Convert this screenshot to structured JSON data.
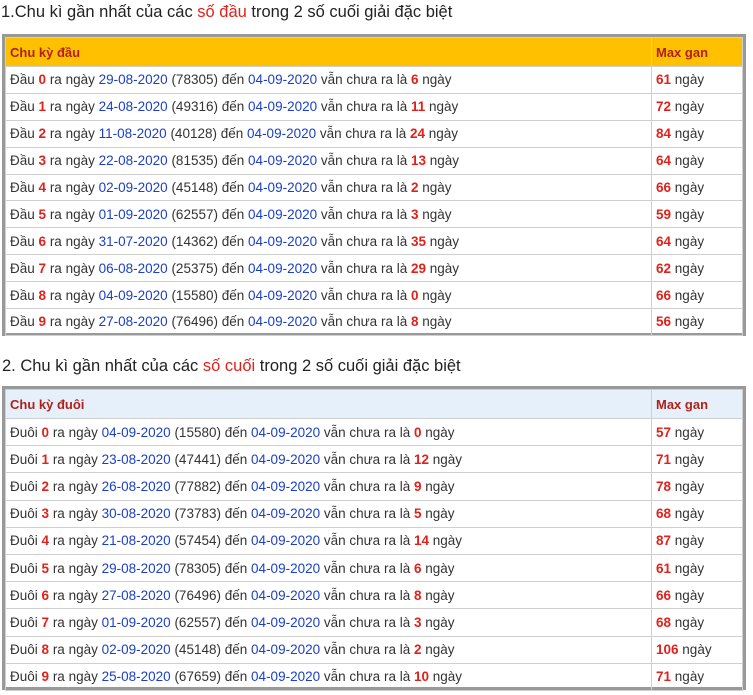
{
  "section1": {
    "title_prefix": "1.Chu kì gần nhất của các ",
    "title_highlight": "số đầu",
    "title_suffix": " trong 2 số cuối giải đặc biệt",
    "header_left": "Chu kỳ đầu",
    "header_right": "Max gan",
    "label": "Đầu",
    "rows": [
      {
        "digit": "0",
        "date": "29-08-2020",
        "code": "(78305)",
        "end": "04-09-2020",
        "days": "6",
        "max": "61"
      },
      {
        "digit": "1",
        "date": "24-08-2020",
        "code": "(49316)",
        "end": "04-09-2020",
        "days": "11",
        "max": "72"
      },
      {
        "digit": "2",
        "date": "11-08-2020",
        "code": "(40128)",
        "end": "04-09-2020",
        "days": "24",
        "max": "84"
      },
      {
        "digit": "3",
        "date": "22-08-2020",
        "code": "(81535)",
        "end": "04-09-2020",
        "days": "13",
        "max": "64"
      },
      {
        "digit": "4",
        "date": "02-09-2020",
        "code": "(45148)",
        "end": "04-09-2020",
        "days": "2",
        "max": "66"
      },
      {
        "digit": "5",
        "date": "01-09-2020",
        "code": "(62557)",
        "end": "04-09-2020",
        "days": "3",
        "max": "59"
      },
      {
        "digit": "6",
        "date": "31-07-2020",
        "code": "(14362)",
        "end": "04-09-2020",
        "days": "35",
        "max": "64"
      },
      {
        "digit": "7",
        "date": "06-08-2020",
        "code": "(25375)",
        "end": "04-09-2020",
        "days": "29",
        "max": "62"
      },
      {
        "digit": "8",
        "date": "04-09-2020",
        "code": "(15580)",
        "end": "04-09-2020",
        "days": "0",
        "max": "66"
      },
      {
        "digit": "9",
        "date": "27-08-2020",
        "code": "(76496)",
        "end": "04-09-2020",
        "days": "8",
        "max": "56"
      }
    ]
  },
  "section2": {
    "title_prefix": "2. Chu kì gần nhất của các ",
    "title_highlight": "số cuối",
    "title_suffix": " trong 2 số cuối giải đặc biệt",
    "header_left": "Chu kỳ đuôi",
    "header_right": "Max gan",
    "label": "Đuôi",
    "rows": [
      {
        "digit": "0",
        "date": "04-09-2020",
        "code": "(15580)",
        "end": "04-09-2020",
        "days": "0",
        "max": "57"
      },
      {
        "digit": "1",
        "date": "23-08-2020",
        "code": "(47441)",
        "end": "04-09-2020",
        "days": "12",
        "max": "71"
      },
      {
        "digit": "2",
        "date": "26-08-2020",
        "code": "(77882)",
        "end": "04-09-2020",
        "days": "9",
        "max": "78"
      },
      {
        "digit": "3",
        "date": "30-08-2020",
        "code": "(73783)",
        "end": "04-09-2020",
        "days": "5",
        "max": "68"
      },
      {
        "digit": "4",
        "date": "21-08-2020",
        "code": "(57454)",
        "end": "04-09-2020",
        "days": "14",
        "max": "87"
      },
      {
        "digit": "5",
        "date": "29-08-2020",
        "code": "(78305)",
        "end": "04-09-2020",
        "days": "6",
        "max": "61"
      },
      {
        "digit": "6",
        "date": "27-08-2020",
        "code": "(76496)",
        "end": "04-09-2020",
        "days": "8",
        "max": "66"
      },
      {
        "digit": "7",
        "date": "01-09-2020",
        "code": "(62557)",
        "end": "04-09-2020",
        "days": "3",
        "max": "68"
      },
      {
        "digit": "8",
        "date": "02-09-2020",
        "code": "(45148)",
        "end": "04-09-2020",
        "days": "2",
        "max": "106"
      },
      {
        "digit": "9",
        "date": "25-08-2020",
        "code": "(67659)",
        "end": "04-09-2020",
        "days": "10",
        "max": "71"
      }
    ]
  },
  "common": {
    "ra_ngay": "ra ngày",
    "den": "đến",
    "van_chua": "vẫn chưa ra là",
    "ngay": "ngày"
  },
  "colors": {
    "header1_bg": "#ffc000",
    "header2_bg": "#e6f0fa",
    "highlight_red": "#e0221c",
    "date_blue": "#1a3fc8"
  }
}
